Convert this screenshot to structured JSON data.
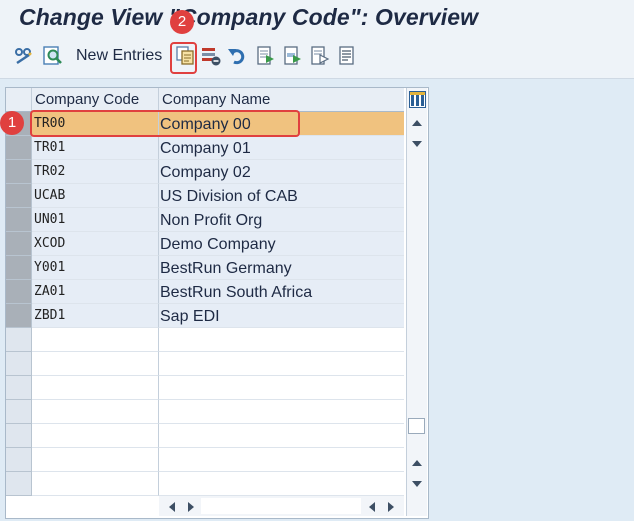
{
  "title": "Change View \"Company Code\": Overview",
  "toolbar": {
    "new_entries_label": "New Entries",
    "icons": [
      "display-change-icon",
      "find-icon",
      "copy-as-icon",
      "delete-icon",
      "undo-icon",
      "select-all-icon",
      "select-block-icon",
      "deselect-all-icon",
      "print-icon"
    ]
  },
  "table": {
    "headers": {
      "code": "Company Code",
      "name": "Company Name"
    },
    "rows": [
      {
        "code": "TR00",
        "name": "Company 00"
      },
      {
        "code": "TR01",
        "name": "Company 01"
      },
      {
        "code": "TR02",
        "name": "Company 02"
      },
      {
        "code": "UCAB",
        "name": "US Division of CAB"
      },
      {
        "code": "UN01",
        "name": "Non Profit Org"
      },
      {
        "code": "XCOD",
        "name": "Demo Company"
      },
      {
        "code": "Y001",
        "name": "BestRun Germany"
      },
      {
        "code": "ZA01",
        "name": "BestRun South Africa"
      },
      {
        "code": "ZBD1",
        "name": "Sap EDI"
      }
    ],
    "selected_row": "TR00"
  },
  "callouts": {
    "step1": "1",
    "step2": "2"
  },
  "colors": {
    "highlight": "#f0c27f",
    "callout": "#e0403f",
    "title": "#1e2a44"
  }
}
